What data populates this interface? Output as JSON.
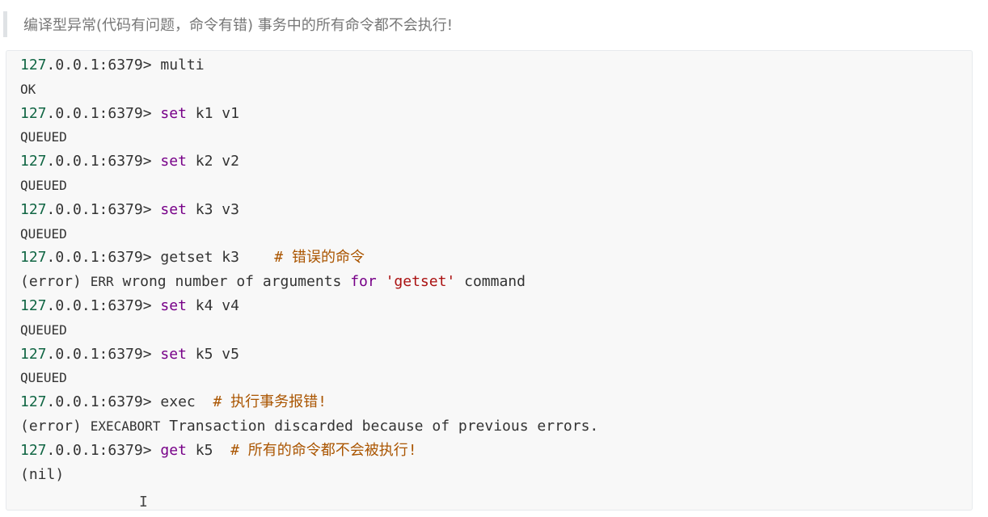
{
  "note": {
    "text": "编译型异常(代码有问题，命令有错) 事务中的所有命令都不会执行!"
  },
  "terminal": {
    "lines": [
      {
        "prompt_num": "127",
        "prompt_rest": ".0.0.1:6379> ",
        "cmd": "multi"
      },
      {
        "output": "OK"
      },
      {
        "prompt_num": "127",
        "prompt_rest": ".0.0.1:6379> ",
        "kw": "set",
        "args": " k1 v1"
      },
      {
        "output": "QUEUED"
      },
      {
        "prompt_num": "127",
        "prompt_rest": ".0.0.1:6379> ",
        "kw": "set",
        "args": " k2 v2"
      },
      {
        "output": "QUEUED"
      },
      {
        "prompt_num": "127",
        "prompt_rest": ".0.0.1:6379> ",
        "kw": "set",
        "args": " k3 v3"
      },
      {
        "output": "QUEUED"
      },
      {
        "prompt_num": "127",
        "prompt_rest": ".0.0.1:6379> ",
        "cmd": "getset k3    ",
        "comment": "# 错误的命令"
      },
      {
        "err_prefix": "(error) ",
        "err_code": "ERR",
        "err_mid": " wrong number of arguments ",
        "err_kw": "for",
        "err_sp": " ",
        "err_str": "'getset'",
        "err_end": " command"
      },
      {
        "prompt_num": "127",
        "prompt_rest": ".0.0.1:6379> ",
        "kw": "set",
        "args": " k4 v4"
      },
      {
        "output": "QUEUED"
      },
      {
        "prompt_num": "127",
        "prompt_rest": ".0.0.1:6379> ",
        "kw": "set",
        "args": " k5 v5"
      },
      {
        "output": "QUEUED"
      },
      {
        "prompt_num": "127",
        "prompt_rest": ".0.0.1:6379> ",
        "cmd": "exec  ",
        "comment": "# 执行事务报错!"
      },
      {
        "err_prefix": "(error) ",
        "err_code": "EXECABORT",
        "err_end": " Transaction discarded because of previous errors."
      },
      {
        "prompt_num": "127",
        "prompt_rest": ".0.0.1:6379> ",
        "kw": "get",
        "args": " k5  ",
        "comment": "# 所有的命令都不会被执行!"
      },
      {
        "output": "(nil)"
      }
    ]
  },
  "cursor": {
    "glyph": "I"
  }
}
